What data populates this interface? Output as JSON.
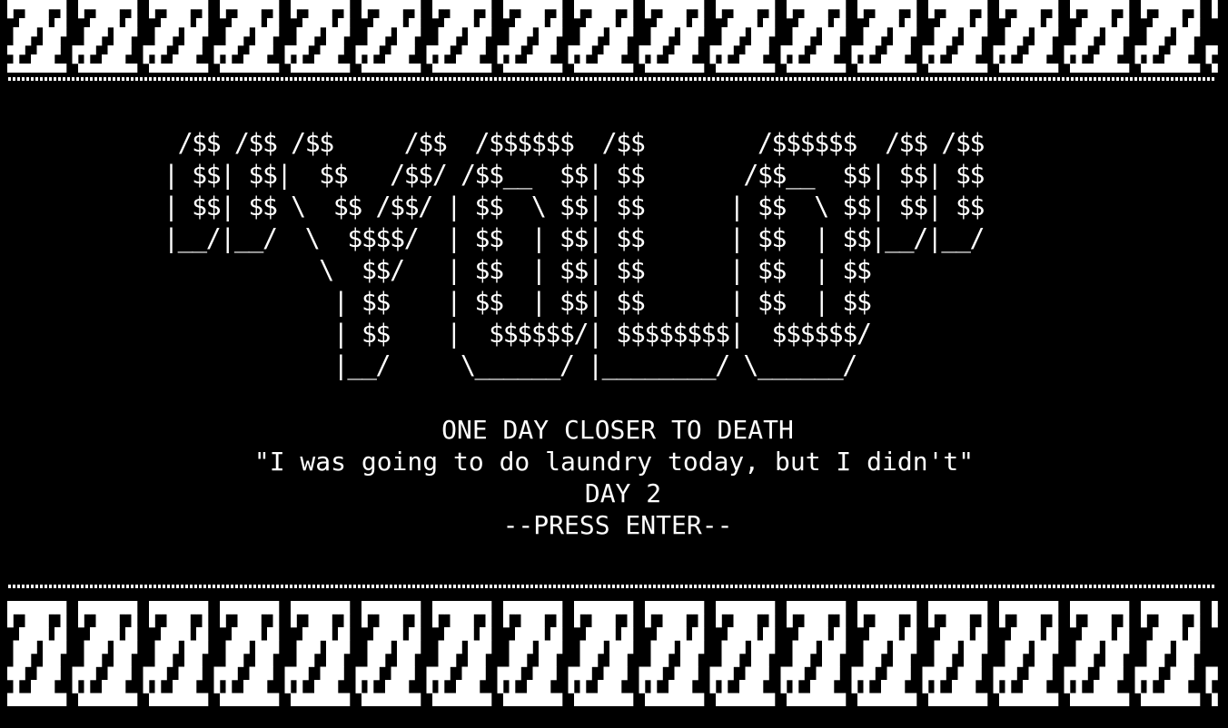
{
  "title_art": [
    " /$$ /$$ /$$     /$$  /$$$$$$  /$$        /$$$$$$  /$$ /$$",
    "| $$| $$|  $$   /$$/ /$$__  $$| $$       /$$__  $$| $$| $$",
    "| $$| $$ \\  $$ /$$/ | $$  \\ $$| $$      | $$  \\ $$| $$| $$",
    "|__/|__/  \\  $$$$/  | $$  | $$| $$      | $$  | $$|__/|__/",
    "           \\  $$/   | $$  | $$| $$      | $$  | $$",
    "            | $$    | $$  | $$| $$      | $$  | $$",
    "            | $$    |  $$$$$$/| $$$$$$$$|  $$$$$$/",
    "            |__/     \\______/ |________/ \\______/"
  ],
  "message": {
    "headline": "ONE DAY CLOSER TO DEATH",
    "quote": "\"I was going to do laundry today, but I didn't\"",
    "day": "DAY 2",
    "prompt": "--PRESS ENTER--"
  },
  "colors": {
    "background": "#000000",
    "foreground": "#ffffff"
  }
}
